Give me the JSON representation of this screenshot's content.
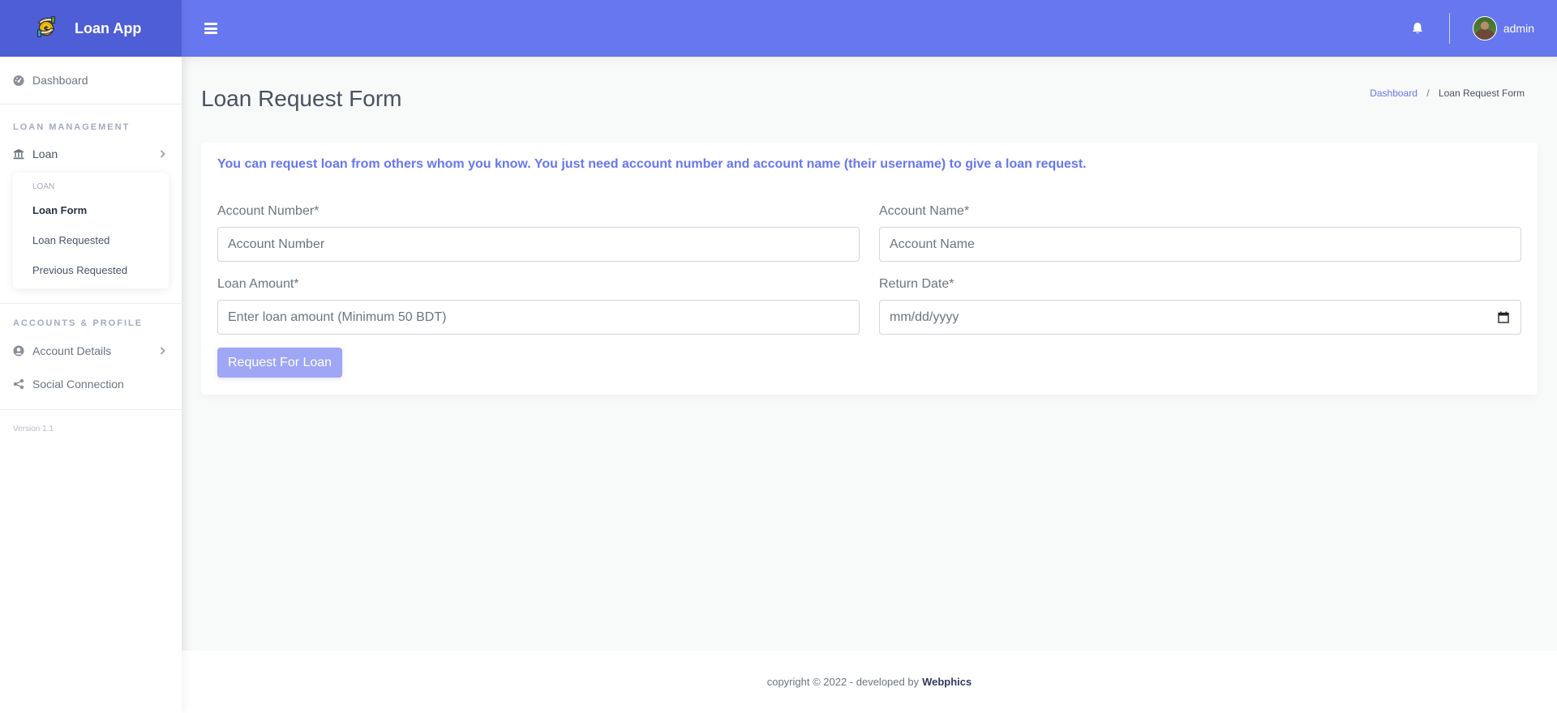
{
  "brand": {
    "name": "Loan App",
    "logo_icon": "money-hands-icon",
    "color": "#4d5ed6"
  },
  "topbar": {
    "color": "#6777ef",
    "menu_icon": "hamburger-icon",
    "notification_icon": "bell-icon",
    "user_name": "admin"
  },
  "sidebar": {
    "dashboard": {
      "label": "Dashboard",
      "icon": "tachometer-icon"
    },
    "sections": [
      {
        "title": "LOAN MANAGEMENT",
        "items": [
          {
            "label": "Loan",
            "icon": "bank-icon",
            "expanded": true,
            "submenu": {
              "title": "LOAN",
              "items": [
                {
                  "label": "Loan Form",
                  "active": true
                },
                {
                  "label": "Loan Requested",
                  "active": false
                },
                {
                  "label": "Previous Requested",
                  "active": false
                }
              ]
            }
          }
        ]
      },
      {
        "title": "ACCOUNTS & PROFILE",
        "items": [
          {
            "label": "Account Details",
            "icon": "user-circle-icon"
          },
          {
            "label": "Social Connection",
            "icon": "share-icon"
          }
        ]
      }
    ],
    "version": "Version 1.1"
  },
  "page": {
    "title": "Loan Request Form",
    "breadcrumb": [
      {
        "label": "Dashboard",
        "link": true
      },
      {
        "label": "Loan Request Form",
        "link": false
      }
    ],
    "breadcrumb_separator": "/"
  },
  "form": {
    "notice": "You can request loan from others whom you know. You just need account number and account name (their username) to give a loan request.",
    "fields": {
      "account_number": {
        "label": "Account Number*",
        "placeholder": "Account Number",
        "value": ""
      },
      "account_name": {
        "label": "Account Name*",
        "placeholder": "Account Name",
        "value": ""
      },
      "loan_amount": {
        "label": "Loan Amount*",
        "placeholder": "Enter loan amount (Minimum 50 BDT)",
        "value": ""
      },
      "return_date": {
        "label": "Return Date*",
        "placeholder": "mm/dd/yyyy",
        "value": ""
      }
    },
    "submit_label": "Request For Loan"
  },
  "footer": {
    "text": "copyright © 2022 - developed by",
    "developer": "Webphics"
  }
}
